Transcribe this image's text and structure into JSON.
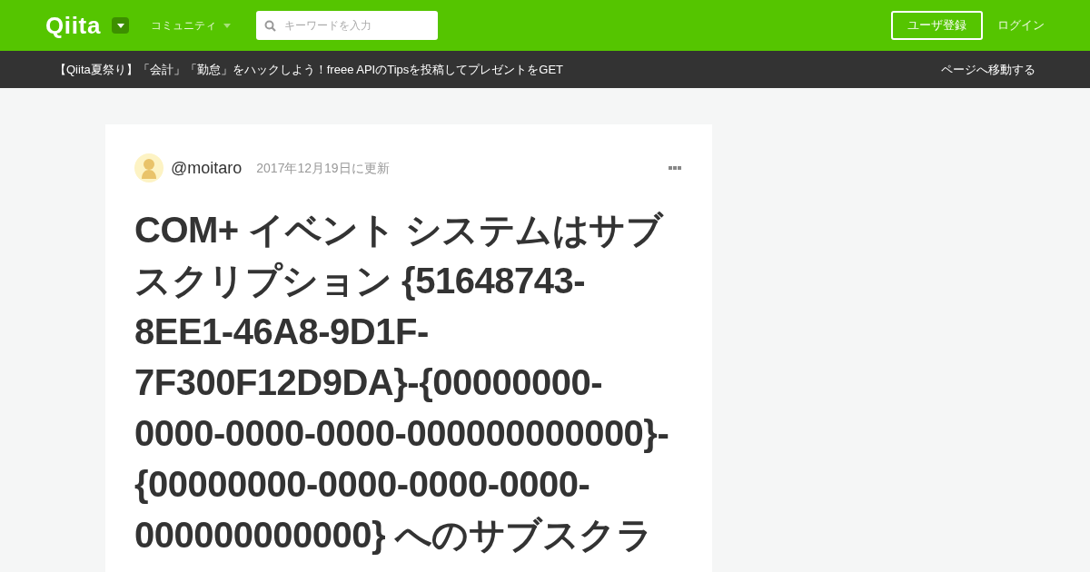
{
  "header": {
    "logo": "Qiita",
    "community_menu": "コミュニティ",
    "search": {
      "placeholder": "キーワードを入力"
    },
    "signup_button": "ユーザ登録",
    "login_link": "ログイン"
  },
  "announcement": {
    "text": "【Qiita夏祭り】「会計」「勤怠」をハックしよう！freee APIのTipsを投稿してプレゼントをGET",
    "link": "ページへ移動する"
  },
  "article": {
    "author": "@moitaro",
    "updated": "2017年12月19日に更新",
    "title_lines": [
      "COM+ イベント システムはサブ",
      "スクリプション {51648743-",
      "8EE1-46A8-9D1F-",
      "7F300F12D9DA}-{00000000-",
      "0000-0000-0000-000000000000}-",
      "{00000000-0000-0000-0000-",
      "000000000000} へのサブスクラ"
    ]
  }
}
